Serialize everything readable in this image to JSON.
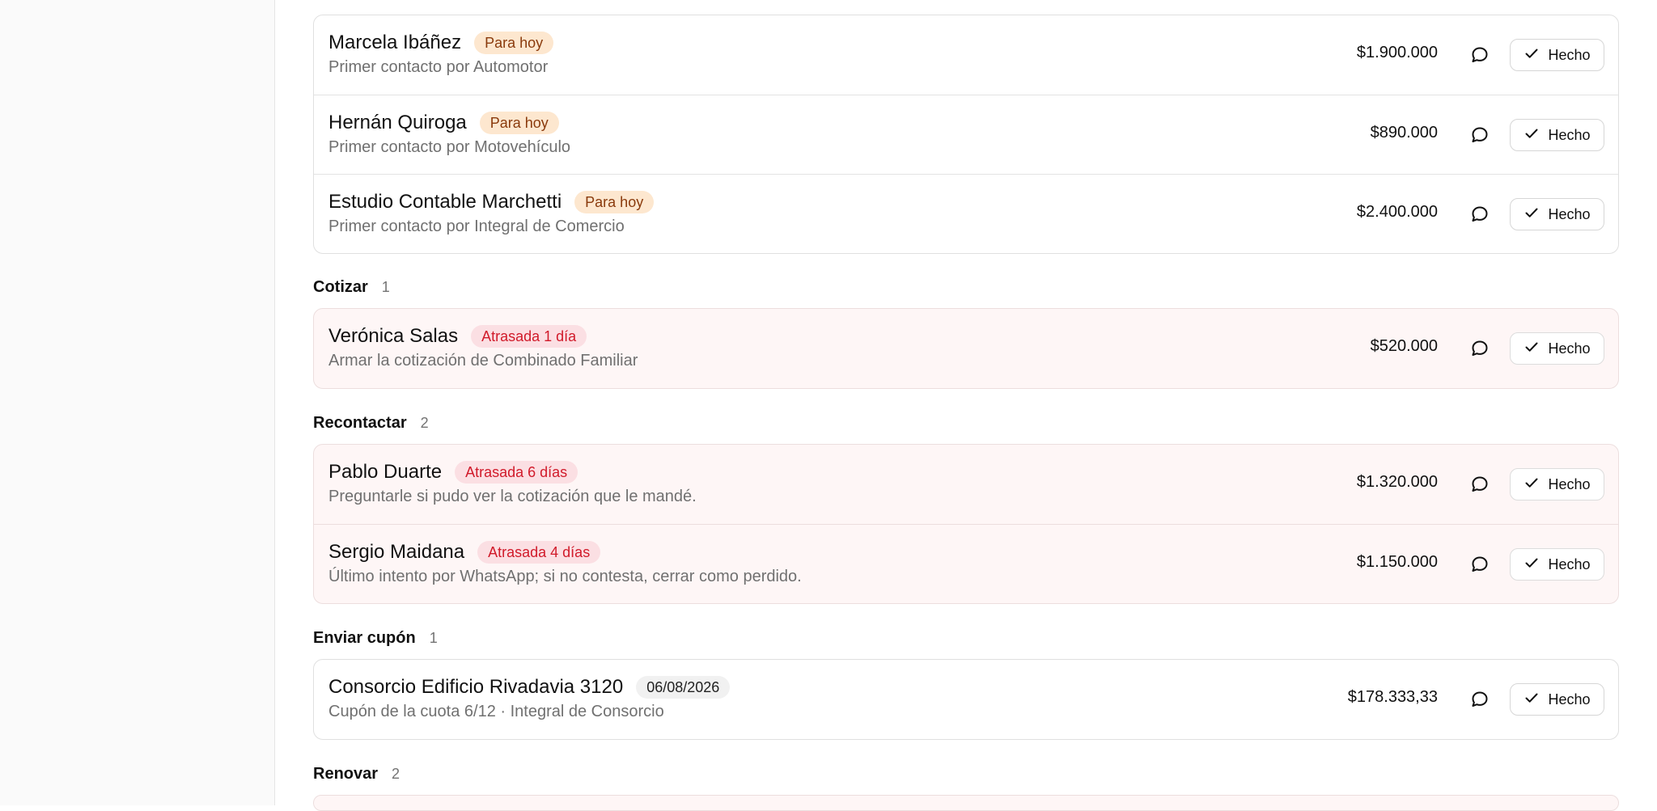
{
  "groups": [
    {
      "title": "",
      "count": "",
      "rows": [
        {
          "name": "Marcela Ibáñez",
          "badge": "Para hoy",
          "badge_kind": "today",
          "description": "Primer contacto por Automotor",
          "amount": "$1.900.000",
          "done_label": "Hecho"
        },
        {
          "name": "Hernán Quiroga",
          "badge": "Para hoy",
          "badge_kind": "today",
          "description": "Primer contacto por Motovehículo",
          "amount": "$890.000",
          "done_label": "Hecho"
        },
        {
          "name": "Estudio Contable Marchetti",
          "badge": "Para hoy",
          "badge_kind": "today",
          "description": "Primer contacto por Integral de Comercio",
          "amount": "$2.400.000",
          "done_label": "Hecho"
        }
      ]
    },
    {
      "title": "Cotizar",
      "count": "1",
      "rows": [
        {
          "name": "Verónica Salas",
          "badge": "Atrasada 1 día",
          "badge_kind": "late",
          "description": "Armar la cotización de Combinado Familiar",
          "amount": "$520.000",
          "done_label": "Hecho"
        }
      ]
    },
    {
      "title": "Recontactar",
      "count": "2",
      "rows": [
        {
          "name": "Pablo Duarte",
          "badge": "Atrasada 6 días",
          "badge_kind": "late",
          "description": "Preguntarle si pudo ver la cotización que le mandé.",
          "amount": "$1.320.000",
          "done_label": "Hecho"
        },
        {
          "name": "Sergio Maidana",
          "badge": "Atrasada 4 días",
          "badge_kind": "late",
          "description": "Último intento por WhatsApp; si no contesta, cerrar como perdido.",
          "amount": "$1.150.000",
          "done_label": "Hecho"
        }
      ]
    },
    {
      "title": "Enviar cupón",
      "count": "1",
      "rows": [
        {
          "name": "Consorcio Edificio Rivadavia 3120",
          "badge": "06/08/2026",
          "badge_kind": "date",
          "description": "Cupón de la cuota 6/12 · Integral de Consorcio",
          "amount": "$178.333,33",
          "done_label": "Hecho"
        }
      ]
    },
    {
      "title": "Renovar",
      "count": "2",
      "rows": []
    }
  ],
  "colors": {
    "today_badge_bg": "#fde7cf",
    "today_badge_text": "#8a3a0c",
    "late_badge_bg": "#fbdfe3",
    "late_badge_text": "#d11a2a",
    "overdue_card_bg": "#fef6f6"
  },
  "icons": {
    "chat": "chat-bubble-icon",
    "check": "check-icon"
  }
}
